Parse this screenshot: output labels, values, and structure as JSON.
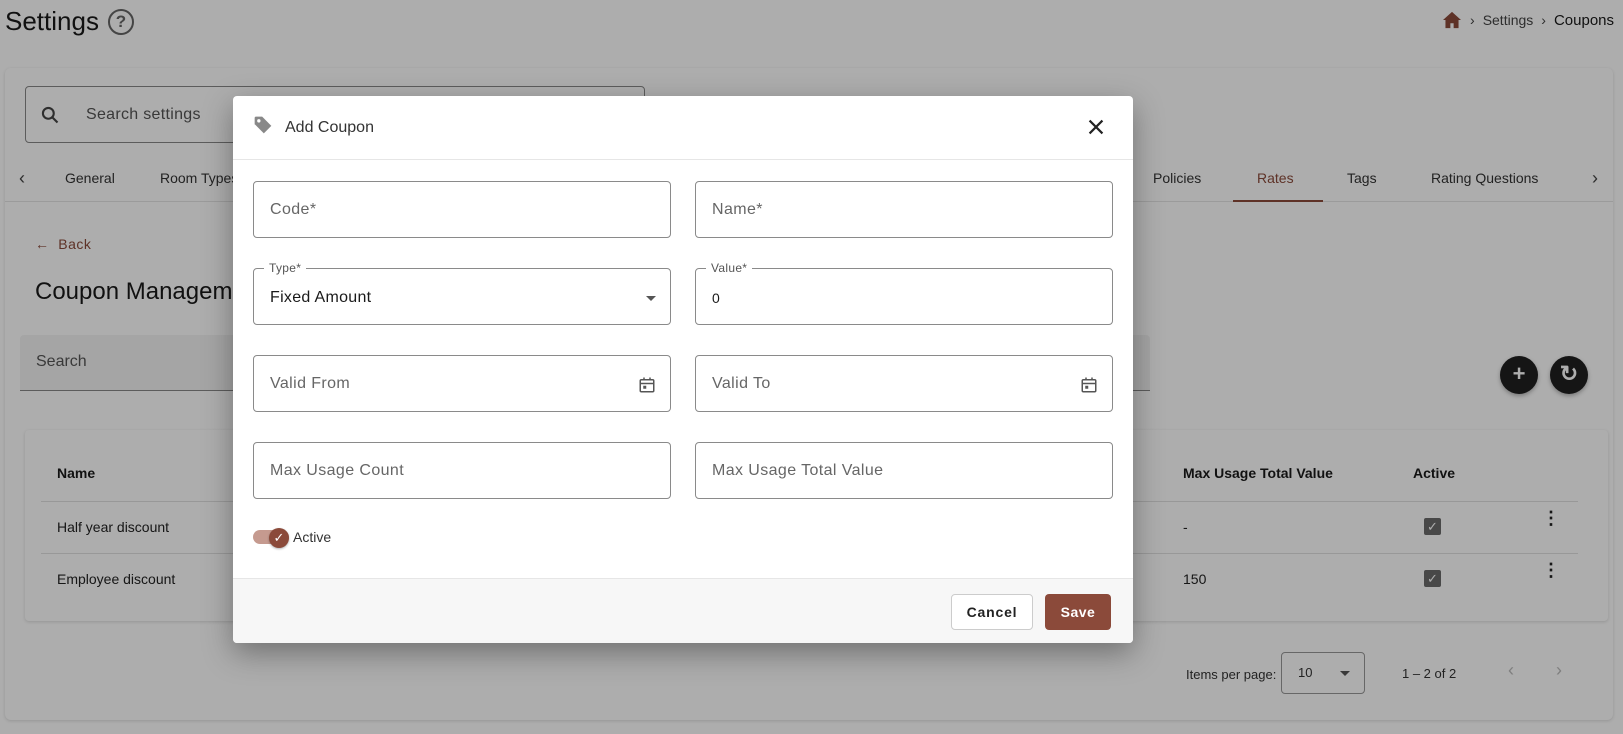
{
  "page": {
    "title": "Settings",
    "help": "?"
  },
  "breadcrumb": {
    "items": [
      "Settings",
      "Coupons"
    ],
    "separator": "›"
  },
  "settings_search": {
    "placeholder": "Search settings"
  },
  "tabs": {
    "prev": "‹",
    "next": "›",
    "items": [
      "General",
      "Room Types",
      "Policies",
      "Rates",
      "Tags",
      "Rating Questions"
    ],
    "active": "Rates"
  },
  "back": {
    "label": "Back"
  },
  "section": {
    "title": "Coupon Manageme"
  },
  "table_search": {
    "placeholder": "Search"
  },
  "fabs": {
    "add": "+",
    "refresh": "↻"
  },
  "table": {
    "columns": [
      "Name",
      "Max Usage Total Value",
      "Active"
    ],
    "rows": [
      {
        "name": "Half year discount",
        "max_usage_total_value": "-",
        "active": true
      },
      {
        "name": "Employee discount",
        "max_usage_total_value": "150",
        "active": true
      }
    ],
    "check_glyph": "✓",
    "menu_glyph": "⋮"
  },
  "paginator": {
    "items_per_page_label": "Items per page:",
    "items_per_page": "10",
    "range": "1 – 2 of 2",
    "prev": "‹",
    "next": "›"
  },
  "dialog": {
    "title": "Add Coupon",
    "fields": {
      "code": {
        "placeholder": "Code*"
      },
      "name": {
        "placeholder": "Name*"
      },
      "type": {
        "label": "Type*",
        "value": "Fixed Amount"
      },
      "value": {
        "label": "Value*",
        "value": "0"
      },
      "valid_from": {
        "placeholder": "Valid From"
      },
      "valid_to": {
        "placeholder": "Valid To"
      },
      "max_usage_count": {
        "placeholder": "Max Usage Count"
      },
      "max_usage_total_value": {
        "placeholder": "Max Usage Total Value"
      }
    },
    "active_toggle": {
      "label": "Active",
      "checked": true,
      "check_glyph": "✓"
    },
    "cancel_label": "Cancel",
    "save_label": "Save"
  },
  "colors": {
    "accent": "#8b4a3a",
    "fab": "#1f1f1f",
    "overlay": "rgba(0,0,0,0.32)"
  },
  "icons": [
    "help-icon",
    "home-icon",
    "search-icon",
    "back-arrow-icon",
    "tag-icon",
    "close-icon",
    "calendar-icon",
    "add-icon",
    "refresh-icon",
    "kebab-menu-icon"
  ]
}
